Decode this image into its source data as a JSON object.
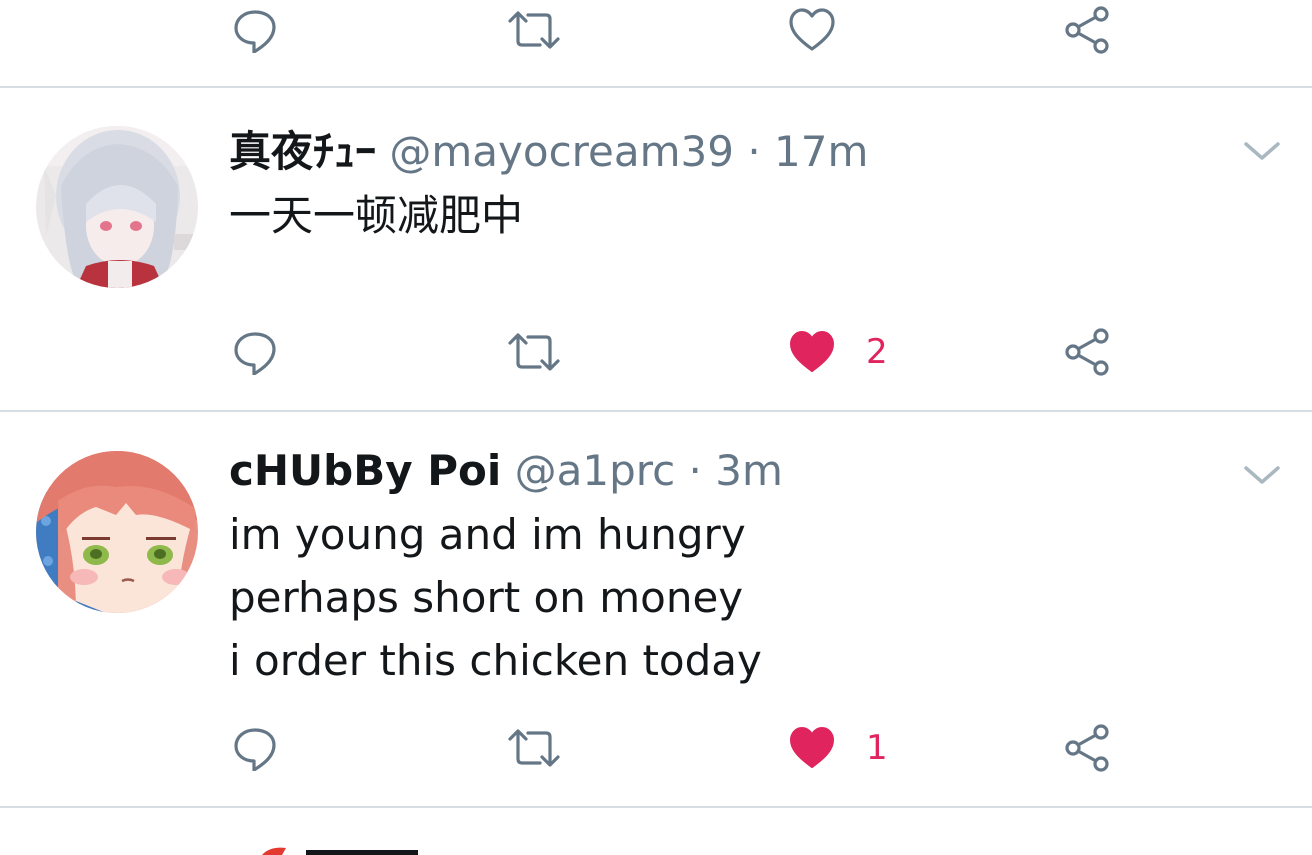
{
  "colors": {
    "accent_like": "#e0245e",
    "secondary_text": "#657786",
    "icon_gray": "#657786",
    "divider": "#d6dde3",
    "primary_text": "#14171a"
  },
  "icons": {
    "reply": "reply-icon",
    "retweet": "retweet-icon",
    "like": "heart-icon",
    "share": "share-icon",
    "caret": "chevron-down-icon"
  },
  "top_action_bar": {
    "liked": false,
    "like_count": ""
  },
  "tweets": [
    {
      "display_name": "真夜ﾁｭｰ",
      "handle": "@mayocream39",
      "separator": "·",
      "time": "17m",
      "text_lines": [
        "一天一顿减肥中"
      ],
      "liked": true,
      "like_count": "2"
    },
    {
      "display_name": "cHUbBy Poi",
      "handle": "@a1prc",
      "separator": "·",
      "time": "3m",
      "text_lines": [
        "im young and im hungry",
        "perhaps short on money",
        "i order this chicken today"
      ],
      "liked": true,
      "like_count": "1"
    }
  ]
}
